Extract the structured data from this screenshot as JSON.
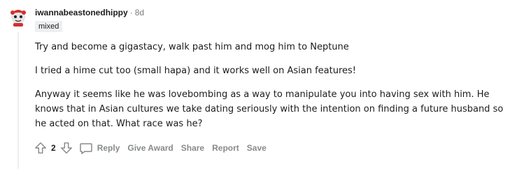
{
  "comment": {
    "username": "iwannabeastonedhippy",
    "separator": "·",
    "age": "8d",
    "flair": "mixed",
    "paragraphs": [
      "Try and become a gigastacy, walk past him and mog him to Neptune",
      "I tried a hime cut too (small hapa) and it works well on Asian features!",
      "Anyway it seems like he was lovebombing as a way to manipulate you into having sex with him. He knows that in Asian cultures we take dating seriously with the intention on finding a future husband so he acted on that. What race was he?"
    ],
    "score": "2",
    "actions": {
      "reply": "Reply",
      "give_award": "Give Award",
      "share": "Share",
      "report": "Report",
      "save": "Save"
    }
  },
  "icons": {
    "upvote": "upvote-arrow-icon",
    "downvote": "downvote-arrow-icon",
    "reply": "comment-bubble-icon",
    "avatar": "snoo-avatar"
  },
  "colors": {
    "meta_gray": "#7c7c7c",
    "action_gray": "#878a8c",
    "flair_bg": "#edeff1",
    "text": "#1c1c1c"
  }
}
